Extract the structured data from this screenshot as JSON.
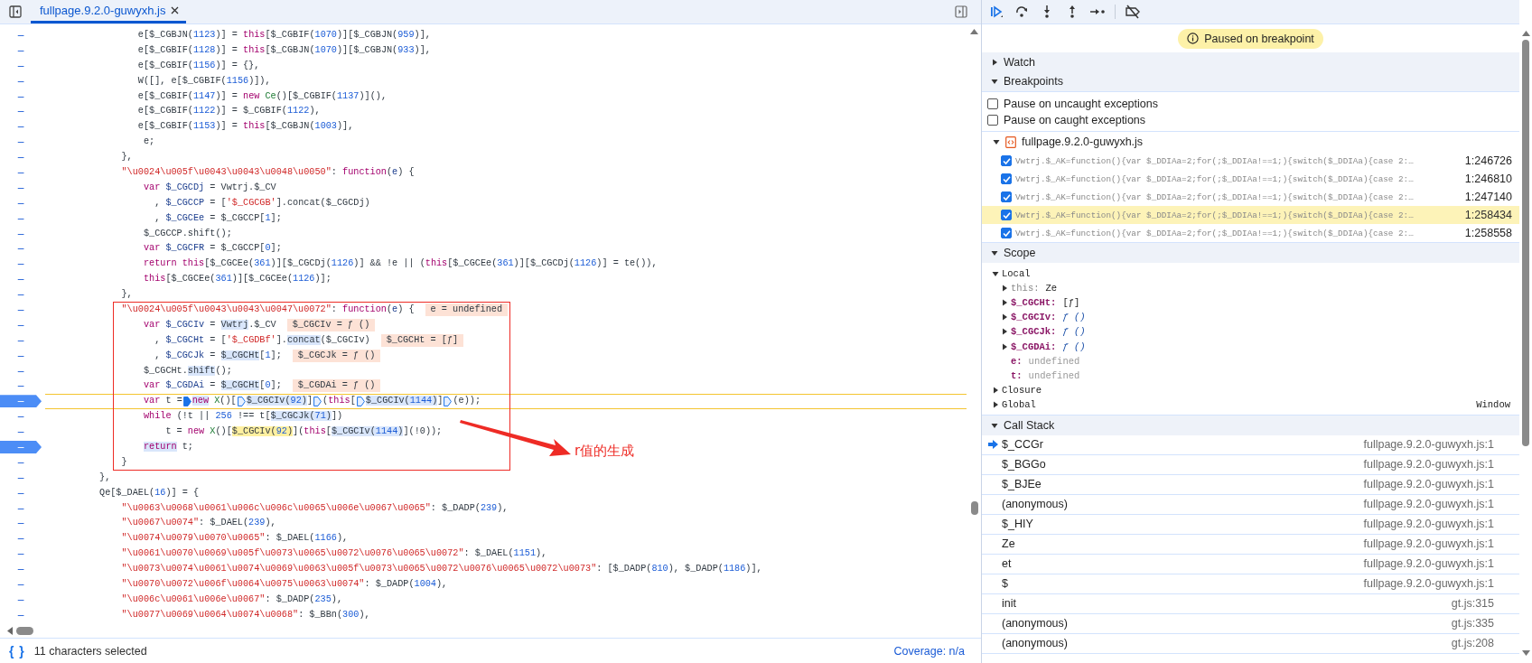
{
  "editor": {
    "tab": {
      "title": "fullpage.9.2.0-guwyxh.js",
      "selected": true
    },
    "lines": [
      {
        "number": "–",
        "breakpoint": false,
        "current": false,
        "segments": [
          {
            "kind": "code",
            "tokens": [
              {
                "kind": "plain",
                "text": "                e[$_CGBJN("
              },
              {
                "kind": "number",
                "text": "1123"
              },
              {
                "kind": "plain",
                "text": ")] = "
              },
              {
                "kind": "keyword",
                "text": "this"
              },
              {
                "kind": "plain",
                "text": "[$_CGBIF("
              },
              {
                "kind": "number",
                "text": "1070"
              },
              {
                "kind": "plain",
                "text": ")][$_CGBJN("
              },
              {
                "kind": "number",
                "text": "959"
              },
              {
                "kind": "plain",
                "text": ")],"
              }
            ]
          }
        ]
      },
      {
        "number": "–",
        "breakpoint": false,
        "current": false,
        "segments": [
          {
            "kind": "code",
            "tokens": [
              {
                "kind": "plain",
                "text": "                e[$_CGBIF("
              },
              {
                "kind": "number",
                "text": "1128"
              },
              {
                "kind": "plain",
                "text": ")] = "
              },
              {
                "kind": "keyword",
                "text": "this"
              },
              {
                "kind": "plain",
                "text": "[$_CGBJN("
              },
              {
                "kind": "number",
                "text": "1070"
              },
              {
                "kind": "plain",
                "text": ")][$_CGBJN("
              },
              {
                "kind": "number",
                "text": "933"
              },
              {
                "kind": "plain",
                "text": ")],"
              }
            ]
          }
        ]
      },
      {
        "number": "–",
        "breakpoint": false,
        "current": false,
        "segments": [
          {
            "kind": "code",
            "tokens": [
              {
                "kind": "plain",
                "text": "                e[$_CGBIF("
              },
              {
                "kind": "number",
                "text": "1156"
              },
              {
                "kind": "plain",
                "text": ")] = {},"
              }
            ]
          }
        ]
      },
      {
        "number": "–",
        "breakpoint": false,
        "current": false,
        "segments": [
          {
            "kind": "code",
            "tokens": [
              {
                "kind": "plain",
                "text": "                W([], e[$_CGBIF("
              },
              {
                "kind": "number",
                "text": "1156"
              },
              {
                "kind": "plain",
                "text": ")]),"
              }
            ]
          }
        ]
      },
      {
        "number": "–",
        "breakpoint": false,
        "current": false,
        "segments": [
          {
            "kind": "code",
            "tokens": [
              {
                "kind": "plain",
                "text": "                e[$_CGBIF("
              },
              {
                "kind": "number",
                "text": "1147"
              },
              {
                "kind": "plain",
                "text": ")] = "
              },
              {
                "kind": "keyword",
                "text": "new"
              },
              {
                "kind": "type",
                "text": " Ce"
              },
              {
                "kind": "plain",
                "text": "()[$_CGBIF("
              },
              {
                "kind": "number",
                "text": "1137"
              },
              {
                "kind": "plain",
                "text": ")](),"
              }
            ]
          }
        ]
      },
      {
        "number": "–",
        "breakpoint": false,
        "current": false,
        "segments": [
          {
            "kind": "code",
            "tokens": [
              {
                "kind": "plain",
                "text": "                e[$_CGBIF("
              },
              {
                "kind": "number",
                "text": "1122"
              },
              {
                "kind": "plain",
                "text": ")] = $_CGBIF("
              },
              {
                "kind": "number",
                "text": "1122"
              },
              {
                "kind": "plain",
                "text": "),"
              }
            ]
          }
        ]
      },
      {
        "number": "–",
        "breakpoint": false,
        "current": false,
        "segments": [
          {
            "kind": "code",
            "tokens": [
              {
                "kind": "plain",
                "text": "                e[$_CGBIF("
              },
              {
                "kind": "number",
                "text": "1153"
              },
              {
                "kind": "plain",
                "text": ")] = "
              },
              {
                "kind": "keyword",
                "text": "this"
              },
              {
                "kind": "plain",
                "text": "[$_CGBJN("
              },
              {
                "kind": "number",
                "text": "1003"
              },
              {
                "kind": "plain",
                "text": ")],"
              }
            ]
          }
        ]
      },
      {
        "number": "–",
        "breakpoint": false,
        "current": false,
        "segments": [
          {
            "kind": "code",
            "tokens": [
              {
                "kind": "plain",
                "text": "                 e;"
              }
            ]
          }
        ]
      },
      {
        "number": "–",
        "breakpoint": false,
        "current": false,
        "segments": [
          {
            "kind": "code",
            "tokens": [
              {
                "kind": "plain",
                "text": "             },"
              }
            ]
          }
        ]
      },
      {
        "number": "–",
        "breakpoint": false,
        "current": false,
        "segments": [
          {
            "kind": "code",
            "tokens": [
              {
                "kind": "string",
                "text": "             \"\\u0024\\u005f\\u0043\\u0043\\u0048\\u0050\""
              },
              {
                "kind": "plain",
                "text": ": "
              },
              {
                "kind": "keyword",
                "text": "function"
              },
              {
                "kind": "plain",
                "text": "("
              },
              {
                "kind": "name",
                "text": "e"
              },
              {
                "kind": "plain",
                "text": ") {"
              }
            ]
          }
        ]
      },
      {
        "number": "–",
        "breakpoint": false,
        "current": false,
        "segments": [
          {
            "kind": "code",
            "tokens": [
              {
                "kind": "keyword",
                "text": "                 var"
              },
              {
                "kind": "name",
                "text": " $_CGCDj"
              },
              {
                "kind": "plain",
                "text": " = Vwtrj.$_CV"
              }
            ]
          }
        ]
      },
      {
        "number": "–",
        "breakpoint": false,
        "current": false,
        "segments": [
          {
            "kind": "code",
            "tokens": [
              {
                "kind": "plain",
                "text": "                   , "
              },
              {
                "kind": "name",
                "text": "$_CGCCP"
              },
              {
                "kind": "plain",
                "text": " = ["
              },
              {
                "kind": "string",
                "text": "'$_CGCGB'"
              },
              {
                "kind": "plain",
                "text": "].concat($_CGCDj)"
              }
            ]
          }
        ]
      },
      {
        "number": "–",
        "breakpoint": false,
        "current": false,
        "segments": [
          {
            "kind": "code",
            "tokens": [
              {
                "kind": "plain",
                "text": "                   , "
              },
              {
                "kind": "name",
                "text": "$_CGCEe"
              },
              {
                "kind": "plain",
                "text": " = $_CGCCP["
              },
              {
                "kind": "number",
                "text": "1"
              },
              {
                "kind": "plain",
                "text": "];"
              }
            ]
          }
        ]
      },
      {
        "number": "–",
        "breakpoint": false,
        "current": false,
        "segments": [
          {
            "kind": "code",
            "tokens": [
              {
                "kind": "plain",
                "text": "                 $_CGCCP.shift();"
              }
            ]
          }
        ]
      },
      {
        "number": "–",
        "breakpoint": false,
        "current": false,
        "segments": [
          {
            "kind": "code",
            "tokens": [
              {
                "kind": "keyword",
                "text": "                 var"
              },
              {
                "kind": "name",
                "text": " $_CGCFR"
              },
              {
                "kind": "plain",
                "text": " = $_CGCCP["
              },
              {
                "kind": "number",
                "text": "0"
              },
              {
                "kind": "plain",
                "text": "];"
              }
            ]
          }
        ]
      },
      {
        "number": "–",
        "breakpoint": false,
        "current": false,
        "segments": [
          {
            "kind": "code",
            "tokens": [
              {
                "kind": "keyword",
                "text": "                 return this"
              },
              {
                "kind": "plain",
                "text": "[$_CGCEe("
              },
              {
                "kind": "number",
                "text": "361"
              },
              {
                "kind": "plain",
                "text": ")][$_CGCDj("
              },
              {
                "kind": "number",
                "text": "1126"
              },
              {
                "kind": "plain",
                "text": ")] && !e || ("
              },
              {
                "kind": "keyword",
                "text": "this"
              },
              {
                "kind": "plain",
                "text": "[$_CGCEe("
              },
              {
                "kind": "number",
                "text": "361"
              },
              {
                "kind": "plain",
                "text": ")][$_CGCDj("
              },
              {
                "kind": "number",
                "text": "1126"
              },
              {
                "kind": "plain",
                "text": ")] = te()),"
              }
            ]
          }
        ]
      },
      {
        "number": "–",
        "breakpoint": false,
        "current": false,
        "segments": [
          {
            "kind": "code",
            "tokens": [
              {
                "kind": "keyword",
                "text": "                 this"
              },
              {
                "kind": "plain",
                "text": "[$_CGCEe("
              },
              {
                "kind": "number",
                "text": "361"
              },
              {
                "kind": "plain",
                "text": ")][$_CGCEe("
              },
              {
                "kind": "number",
                "text": "1126"
              },
              {
                "kind": "plain",
                "text": ")];"
              }
            ]
          }
        ]
      },
      {
        "number": "–",
        "breakpoint": false,
        "current": false,
        "segments": [
          {
            "kind": "code",
            "tokens": [
              {
                "kind": "plain",
                "text": "             },"
              }
            ]
          }
        ]
      },
      {
        "number": "–",
        "breakpoint": false,
        "current": false,
        "segments": [
          {
            "kind": "code",
            "tokens": [
              {
                "kind": "string",
                "text": "             \"\\u0024\\u005f\\u0043\\u0043\\u0047\\u0072\""
              },
              {
                "kind": "plain",
                "text": ": "
              },
              {
                "kind": "keyword",
                "text": "function"
              },
              {
                "kind": "plain",
                "text": "("
              },
              {
                "kind": "name",
                "text": "e"
              },
              {
                "kind": "plain",
                "text": ") {"
              }
            ]
          },
          {
            "kind": "value",
            "text": "e = undefined"
          }
        ]
      },
      {
        "number": "–",
        "breakpoint": false,
        "current": false,
        "segments": [
          {
            "kind": "code",
            "tokens": [
              {
                "kind": "keyword",
                "text": "                 var"
              },
              {
                "kind": "name",
                "text": " $_CGCIv"
              },
              {
                "kind": "plain",
                "text": " = "
              },
              {
                "kind": "plain",
                "text": "Vwtrj",
                "highlighted": true
              },
              {
                "kind": "plain",
                "text": ".$_CV"
              }
            ]
          },
          {
            "kind": "value",
            "text": "$_CGCIv = ƒ ()"
          }
        ]
      },
      {
        "number": "–",
        "breakpoint": false,
        "current": false,
        "segments": [
          {
            "kind": "code",
            "tokens": [
              {
                "kind": "plain",
                "text": "                   , "
              },
              {
                "kind": "name",
                "text": "$_CGCHt"
              },
              {
                "kind": "plain",
                "text": " = ["
              },
              {
                "kind": "string",
                "text": "'$_CGDBf'"
              },
              {
                "kind": "plain",
                "text": "]."
              },
              {
                "kind": "plain",
                "text": "concat",
                "highlighted": true
              },
              {
                "kind": "plain",
                "text": "($_CGCIv)"
              }
            ]
          },
          {
            "kind": "value",
            "text": "$_CGCHt = [ƒ]"
          }
        ]
      },
      {
        "number": "–",
        "breakpoint": false,
        "current": false,
        "segments": [
          {
            "kind": "code",
            "tokens": [
              {
                "kind": "plain",
                "text": "                   , "
              },
              {
                "kind": "name",
                "text": "$_CGCJk"
              },
              {
                "kind": "plain",
                "text": " = "
              },
              {
                "kind": "plain",
                "text": "$_CGCHt",
                "highlighted": true
              },
              {
                "kind": "plain",
                "text": "["
              },
              {
                "kind": "number",
                "text": "1"
              },
              {
                "kind": "plain",
                "text": "];"
              }
            ]
          },
          {
            "kind": "value",
            "text": "$_CGCJk = ƒ ()"
          }
        ]
      },
      {
        "number": "–",
        "breakpoint": false,
        "current": false,
        "segments": [
          {
            "kind": "code",
            "tokens": [
              {
                "kind": "plain",
                "text": "                 $_CGCHt."
              },
              {
                "kind": "plain",
                "text": "shift",
                "highlighted": true
              },
              {
                "kind": "plain",
                "text": "();"
              }
            ]
          }
        ]
      },
      {
        "number": "–",
        "breakpoint": false,
        "current": false,
        "segments": [
          {
            "kind": "code",
            "tokens": [
              {
                "kind": "keyword",
                "text": "                 var"
              },
              {
                "kind": "name",
                "text": " $_CGDAi"
              },
              {
                "kind": "plain",
                "text": " = "
              },
              {
                "kind": "plain",
                "text": "$_CGCHt",
                "highlighted": true
              },
              {
                "kind": "plain",
                "text": "["
              },
              {
                "kind": "number",
                "text": "0"
              },
              {
                "kind": "plain",
                "text": "];"
              }
            ]
          },
          {
            "kind": "value",
            "text": "$_CGDAi = ƒ ()"
          }
        ]
      },
      {
        "number": "–",
        "breakpoint": true,
        "current": true,
        "segments": [
          {
            "kind": "code",
            "tokens": [
              {
                "kind": "keyword",
                "text": "                 var"
              },
              {
                "kind": "plain",
                "text": " t ="
              }
            ]
          },
          {
            "kind": "stop",
            "on": true
          },
          {
            "kind": "code",
            "tokens": [
              {
                "kind": "keyword",
                "text": "new",
                "highlighted": true
              },
              {
                "kind": "type",
                "text": " X"
              },
              {
                "kind": "plain",
                "text": "()["
              }
            ]
          },
          {
            "kind": "stop",
            "on": false
          },
          {
            "kind": "code",
            "tokens": [
              {
                "kind": "plain",
                "text": "$_CGCIv(",
                "highlighted": true
              },
              {
                "kind": "number",
                "text": "92",
                "highlighted": true
              },
              {
                "kind": "plain",
                "text": ")",
                "highlighted": true
              },
              {
                "kind": "plain",
                "text": "]"
              }
            ]
          },
          {
            "kind": "stop",
            "on": false
          },
          {
            "kind": "code",
            "tokens": [
              {
                "kind": "plain",
                "text": "("
              },
              {
                "kind": "keyword",
                "text": "this"
              },
              {
                "kind": "plain",
                "text": "["
              }
            ]
          },
          {
            "kind": "stop",
            "on": false
          },
          {
            "kind": "code",
            "tokens": [
              {
                "kind": "plain",
                "text": "$_CGCIv(",
                "highlighted": true
              },
              {
                "kind": "number",
                "text": "1144",
                "highlighted": true
              },
              {
                "kind": "plain",
                "text": ")",
                "highlighted": true
              },
              {
                "kind": "plain",
                "text": "]"
              }
            ]
          },
          {
            "kind": "stop",
            "on": false
          },
          {
            "kind": "code",
            "tokens": [
              {
                "kind": "plain",
                "text": "(e));"
              }
            ]
          }
        ]
      },
      {
        "number": "–",
        "breakpoint": false,
        "current": false,
        "segments": [
          {
            "kind": "code",
            "tokens": [
              {
                "kind": "keyword",
                "text": "                 while"
              },
              {
                "kind": "plain",
                "text": " (!t || "
              },
              {
                "kind": "number",
                "text": "256"
              },
              {
                "kind": "plain",
                "text": " !== t["
              },
              {
                "kind": "plain",
                "text": "$_CGCJk(",
                "highlighted": true
              },
              {
                "kind": "number",
                "text": "71",
                "highlighted": true
              },
              {
                "kind": "plain",
                "text": ")",
                "highlighted": true
              },
              {
                "kind": "plain",
                "text": "])"
              }
            ]
          }
        ]
      },
      {
        "number": "–",
        "breakpoint": false,
        "current": false,
        "segments": [
          {
            "kind": "code",
            "tokens": [
              {
                "kind": "plain",
                "text": "                     t = "
              },
              {
                "kind": "keyword",
                "text": "new"
              },
              {
                "kind": "type",
                "text": " X"
              },
              {
                "kind": "plain",
                "text": "()["
              },
              {
                "kind": "plain",
                "text": "$_CGCIv(",
                "focused": true
              },
              {
                "kind": "number",
                "text": "92",
                "focused": true
              },
              {
                "kind": "plain",
                "text": ")",
                "focused": true
              },
              {
                "kind": "plain",
                "text": "]("
              },
              {
                "kind": "keyword",
                "text": "this"
              },
              {
                "kind": "plain",
                "text": "["
              },
              {
                "kind": "plain",
                "text": "$_CGCIv(",
                "highlighted": true
              },
              {
                "kind": "number",
                "text": "1144",
                "highlighted": true
              },
              {
                "kind": "plain",
                "text": ")",
                "highlighted": true
              },
              {
                "kind": "plain",
                "text": "](!0));"
              }
            ]
          }
        ]
      },
      {
        "number": "–",
        "breakpoint": true,
        "current": false,
        "segments": [
          {
            "kind": "code",
            "tokens": [
              {
                "kind": "keyword",
                "text": "                 return",
                "highlighted": true
              },
              {
                "kind": "plain",
                "text": " t;"
              }
            ]
          }
        ]
      },
      {
        "number": "–",
        "breakpoint": false,
        "current": false,
        "segments": [
          {
            "kind": "code",
            "tokens": [
              {
                "kind": "plain",
                "text": "             }"
              }
            ]
          }
        ]
      },
      {
        "number": "–",
        "breakpoint": false,
        "current": false,
        "segments": [
          {
            "kind": "code",
            "tokens": [
              {
                "kind": "plain",
                "text": "         },"
              }
            ]
          }
        ]
      },
      {
        "number": "–",
        "breakpoint": false,
        "current": false,
        "segments": [
          {
            "kind": "code",
            "tokens": [
              {
                "kind": "plain",
                "text": "         Qe[$_DAEL("
              },
              {
                "kind": "number",
                "text": "16"
              },
              {
                "kind": "plain",
                "text": ")] = {"
              }
            ]
          }
        ]
      },
      {
        "number": "–",
        "breakpoint": false,
        "current": false,
        "segments": [
          {
            "kind": "code",
            "tokens": [
              {
                "kind": "string",
                "text": "             \"\\u0063\\u0068\\u0061\\u006c\\u006c\\u0065\\u006e\\u0067\\u0065\""
              },
              {
                "kind": "plain",
                "text": ": $_DADP("
              },
              {
                "kind": "number",
                "text": "239"
              },
              {
                "kind": "plain",
                "text": "),"
              }
            ]
          }
        ]
      },
      {
        "number": "–",
        "breakpoint": false,
        "current": false,
        "segments": [
          {
            "kind": "code",
            "tokens": [
              {
                "kind": "string",
                "text": "             \"\\u0067\\u0074\""
              },
              {
                "kind": "plain",
                "text": ": $_DAEL("
              },
              {
                "kind": "number",
                "text": "239"
              },
              {
                "kind": "plain",
                "text": "),"
              }
            ]
          }
        ]
      },
      {
        "number": "–",
        "breakpoint": false,
        "current": false,
        "segments": [
          {
            "kind": "code",
            "tokens": [
              {
                "kind": "string",
                "text": "             \"\\u0074\\u0079\\u0070\\u0065\""
              },
              {
                "kind": "plain",
                "text": ": $_DAEL("
              },
              {
                "kind": "number",
                "text": "1166"
              },
              {
                "kind": "plain",
                "text": "),"
              }
            ]
          }
        ]
      },
      {
        "number": "–",
        "breakpoint": false,
        "current": false,
        "segments": [
          {
            "kind": "code",
            "tokens": [
              {
                "kind": "string",
                "text": "             \"\\u0061\\u0070\\u0069\\u005f\\u0073\\u0065\\u0072\\u0076\\u0065\\u0072\""
              },
              {
                "kind": "plain",
                "text": ": $_DAEL("
              },
              {
                "kind": "number",
                "text": "1151"
              },
              {
                "kind": "plain",
                "text": "),"
              }
            ]
          }
        ]
      },
      {
        "number": "–",
        "breakpoint": false,
        "current": false,
        "segments": [
          {
            "kind": "code",
            "tokens": [
              {
                "kind": "string",
                "text": "             \"\\u0073\\u0074\\u0061\\u0074\\u0069\\u0063\\u005f\\u0073\\u0065\\u0072\\u0076\\u0065\\u0072\\u0073\""
              },
              {
                "kind": "plain",
                "text": ": [$_DADP("
              },
              {
                "kind": "number",
                "text": "810"
              },
              {
                "kind": "plain",
                "text": "), $_DADP("
              },
              {
                "kind": "number",
                "text": "1186"
              },
              {
                "kind": "plain",
                "text": ")],"
              }
            ]
          }
        ]
      },
      {
        "number": "–",
        "breakpoint": false,
        "current": false,
        "segments": [
          {
            "kind": "code",
            "tokens": [
              {
                "kind": "string",
                "text": "             \"\\u0070\\u0072\\u006f\\u0064\\u0075\\u0063\\u0074\""
              },
              {
                "kind": "plain",
                "text": ": $_DADP("
              },
              {
                "kind": "number",
                "text": "1004"
              },
              {
                "kind": "plain",
                "text": "),"
              }
            ]
          }
        ]
      },
      {
        "number": "–",
        "breakpoint": false,
        "current": false,
        "segments": [
          {
            "kind": "code",
            "tokens": [
              {
                "kind": "string",
                "text": "             \"\\u006c\\u0061\\u006e\\u0067\""
              },
              {
                "kind": "plain",
                "text": ": $_DADP("
              },
              {
                "kind": "number",
                "text": "235"
              },
              {
                "kind": "plain",
                "text": "),"
              }
            ]
          }
        ]
      },
      {
        "number": "–",
        "breakpoint": false,
        "current": false,
        "segments": [
          {
            "kind": "code",
            "tokens": [
              {
                "kind": "string",
                "text": "             \"\\u0077\\u0069\\u0064\\u0074\\u0068\""
              },
              {
                "kind": "plain",
                "text": ": $_BBn("
              },
              {
                "kind": "number",
                "text": "300"
              },
              {
                "kind": "plain",
                "text": "),"
              }
            ]
          }
        ]
      }
    ],
    "annotation": {
      "label": "r值的生成"
    }
  },
  "status_bar": {
    "pretty_print": "{ }",
    "selection": "11 characters selected",
    "coverage": "Coverage: n/a"
  },
  "debugger": {
    "status": "Paused on breakpoint",
    "watch": {
      "title": "Watch",
      "expanded": false
    },
    "breakpoints": {
      "title": "Breakpoints",
      "expanded": true,
      "options": [
        {
          "label": "Pause on uncaught exceptions",
          "checked": false
        },
        {
          "label": "Pause on caught exceptions",
          "checked": false
        }
      ],
      "files": [
        {
          "name": "fullpage.9.2.0-guwyxh.js",
          "expanded": true,
          "items": [
            {
              "code": "Vwtrj.$_AK=function(){var $_DDIAa=2;for(;$_DDIAa!==1;){switch($_DDIAa){case 2:…",
              "location": "1:246726",
              "checked": true,
              "selected": false
            },
            {
              "code": "Vwtrj.$_AK=function(){var $_DDIAa=2;for(;$_DDIAa!==1;){switch($_DDIAa){case 2:…",
              "location": "1:246810",
              "checked": true,
              "selected": false
            },
            {
              "code": "Vwtrj.$_AK=function(){var $_DDIAa=2;for(;$_DDIAa!==1;){switch($_DDIAa){case 2:…",
              "location": "1:247140",
              "checked": true,
              "selected": false
            },
            {
              "code": "Vwtrj.$_AK=function(){var $_DDIAa=2;for(;$_DDIAa!==1;){switch($_DDIAa){case 2:…",
              "location": "1:258434",
              "checked": true,
              "selected": true
            },
            {
              "code": "Vwtrj.$_AK=function(){var $_DDIAa=2;for(;$_DDIAa!==1;){switch($_DDIAa){case 2:…",
              "location": "1:258558",
              "checked": true,
              "selected": false
            }
          ]
        }
      ]
    },
    "scope": {
      "title": "Scope",
      "expanded": true,
      "groups": [
        {
          "name": "Local",
          "expanded": true,
          "items": [
            {
              "name": "this:",
              "value": "Ze",
              "kind": "object",
              "expandable": true
            },
            {
              "name": "$_CGCHt:",
              "value": "[ƒ]",
              "kind": "array",
              "expandable": true
            },
            {
              "name": "$_CGCIv:",
              "value": "ƒ ()",
              "kind": "function",
              "expandable": true
            },
            {
              "name": "$_CGCJk:",
              "value": "ƒ ()",
              "kind": "function",
              "expandable": true
            },
            {
              "name": "$_CGDAi:",
              "value": "ƒ ()",
              "kind": "function",
              "expandable": true
            },
            {
              "name": "e:",
              "value": "undefined",
              "kind": "undefined",
              "expandable": false
            },
            {
              "name": "t:",
              "value": "undefined",
              "kind": "undefined",
              "expandable": false
            }
          ]
        },
        {
          "name": "Closure",
          "expanded": false
        },
        {
          "name": "Global",
          "expanded": false,
          "value": "Window"
        }
      ]
    },
    "call_stack": {
      "title": "Call Stack",
      "expanded": true,
      "frames": [
        {
          "function": "$_CCGr",
          "location": "fullpage.9.2.0-guwyxh.js:1",
          "selected": true
        },
        {
          "function": "$_BGGo",
          "location": "fullpage.9.2.0-guwyxh.js:1",
          "selected": false
        },
        {
          "function": "$_BJEe",
          "location": "fullpage.9.2.0-guwyxh.js:1",
          "selected": false
        },
        {
          "function": "(anonymous)",
          "location": "fullpage.9.2.0-guwyxh.js:1",
          "selected": false
        },
        {
          "function": "$_HIY",
          "location": "fullpage.9.2.0-guwyxh.js:1",
          "selected": false
        },
        {
          "function": "Ze",
          "location": "fullpage.9.2.0-guwyxh.js:1",
          "selected": false
        },
        {
          "function": "et",
          "location": "fullpage.9.2.0-guwyxh.js:1",
          "selected": false
        },
        {
          "function": "$",
          "location": "fullpage.9.2.0-guwyxh.js:1",
          "selected": false
        },
        {
          "function": "init",
          "location": "gt.js:315",
          "selected": false
        },
        {
          "function": "(anonymous)",
          "location": "gt.js:335",
          "selected": false
        },
        {
          "function": "(anonymous)",
          "location": "gt.js:208",
          "selected": false
        }
      ]
    }
  }
}
